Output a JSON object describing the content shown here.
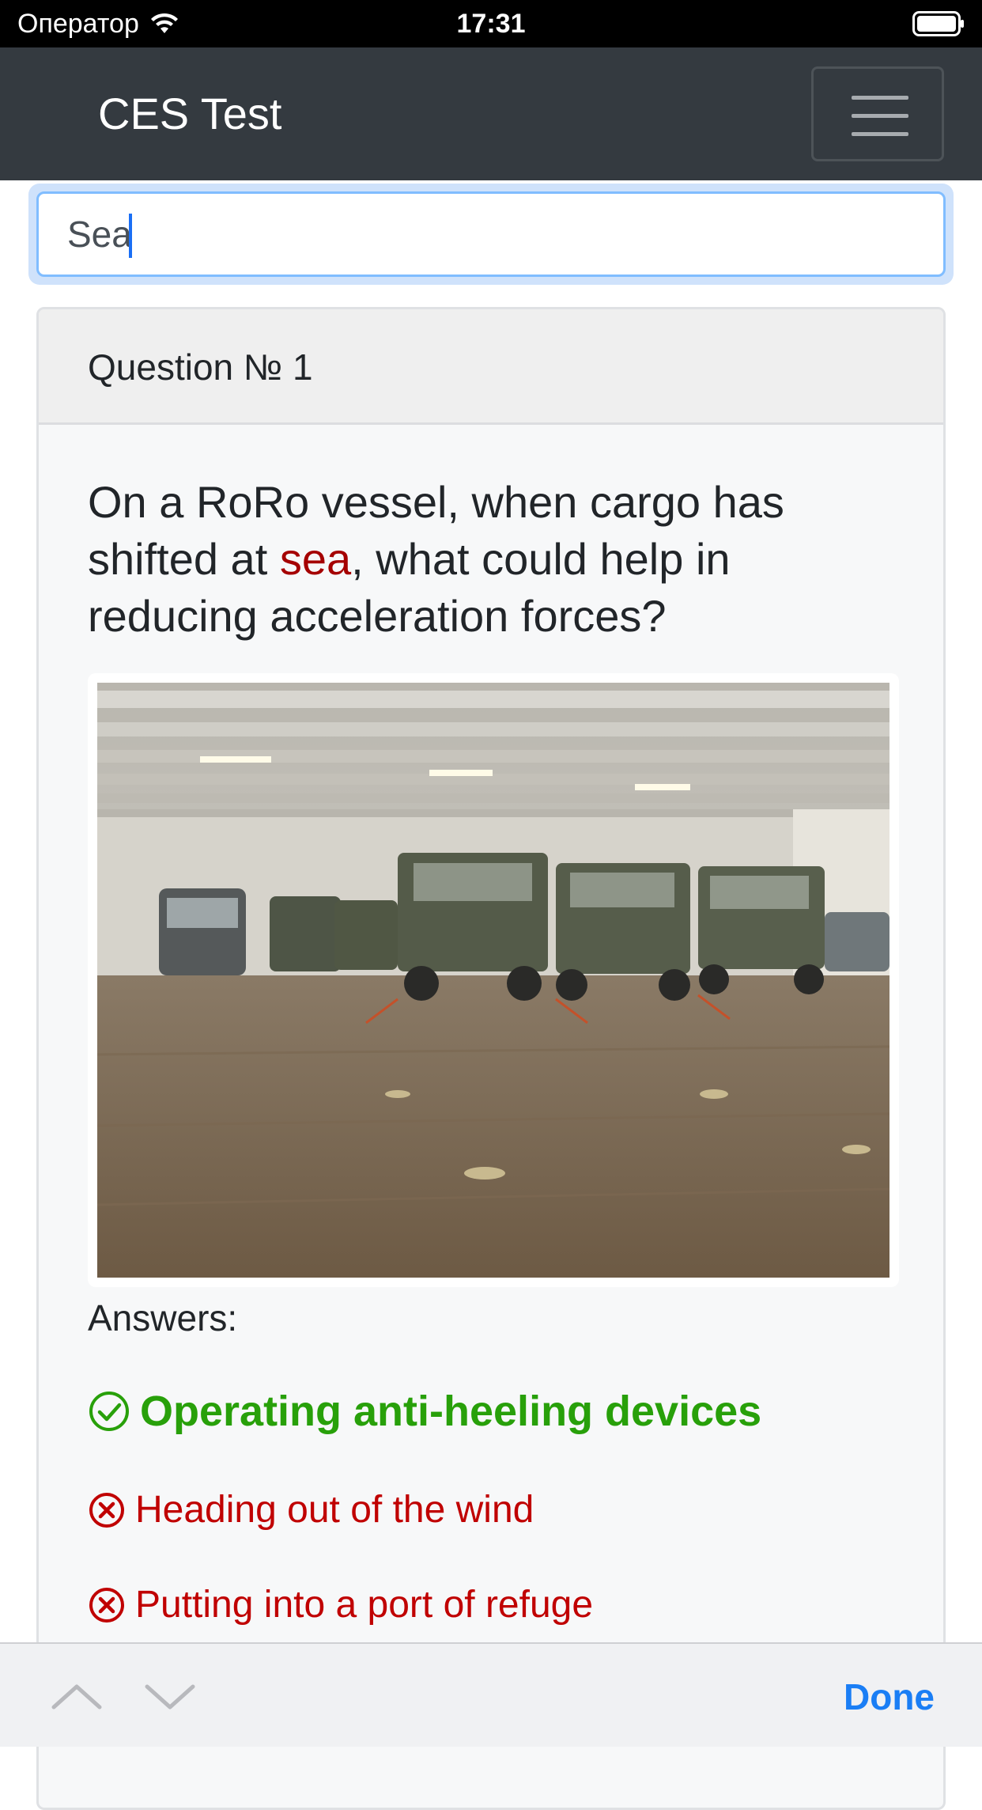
{
  "status_bar": {
    "carrier": "Оператор",
    "time": "17:31",
    "icons": [
      "wifi-icon",
      "battery-icon"
    ]
  },
  "navbar": {
    "brand": "CES Test",
    "menu_icon": "hamburger-icon"
  },
  "search": {
    "value": "Sea",
    "placeholder": ""
  },
  "card": {
    "header": "Question № 1",
    "question_before": "On a RoRo vessel, when cargo has shifted at ",
    "question_highlight": "sea",
    "question_after": ", what could help in reducing acceleration forces?",
    "image_alt": "Military vehicles lashed on the deck of a RoRo vessel",
    "answers_label": "Answers:",
    "answers": [
      {
        "text": "Operating anti-heeling devices",
        "correct": true,
        "icon": "check-circle-icon"
      },
      {
        "text": "Heading out of the wind",
        "correct": false,
        "icon": "x-circle-icon"
      },
      {
        "text": "Putting into a port of refuge",
        "correct": false,
        "icon": "x-circle-icon"
      }
    ]
  },
  "keyboard_toolbar": {
    "prev_icon": "chevron-up-icon",
    "next_icon": "chevron-down-icon",
    "done_label": "Done"
  },
  "colors": {
    "navbar_bg": "#343a40",
    "correct": "#28a00a",
    "wrong": "#c00000",
    "highlight": "#a50000",
    "accent": "#1a7ef5"
  }
}
